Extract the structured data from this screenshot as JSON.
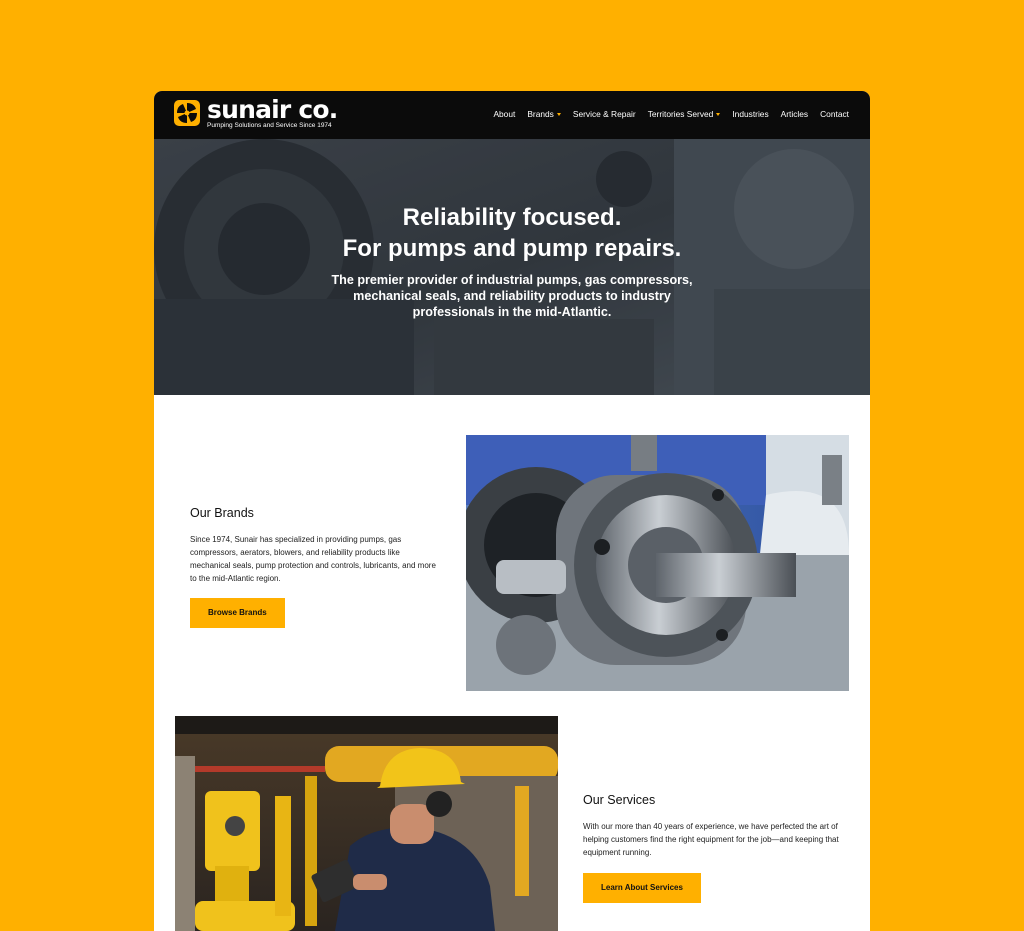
{
  "header": {
    "logo_name": "sunair co.",
    "logo_tagline": "Pumping Solutions and Service Since 1974",
    "nav": [
      {
        "label": "About",
        "has_dropdown": false
      },
      {
        "label": "Brands",
        "has_dropdown": true
      },
      {
        "label": "Service & Repair",
        "has_dropdown": false
      },
      {
        "label": "Territories Served",
        "has_dropdown": true
      },
      {
        "label": "Industries",
        "has_dropdown": false
      },
      {
        "label": "Articles",
        "has_dropdown": false
      },
      {
        "label": "Contact",
        "has_dropdown": false
      }
    ]
  },
  "hero": {
    "title_line1": "Reliability focused.",
    "title_line2": "For pumps and pump repairs.",
    "subtitle": "The premier provider of industrial pumps, gas compressors, mechanical seals, and reliability products to industry professionals in the mid-Atlantic."
  },
  "brands": {
    "title": "Our Brands",
    "body": "Since 1974, Sunair has specialized in providing pumps, gas compressors, aerators, blowers, and reliability products like mechanical seals, pump protection and controls, lubricants, and more to the mid-Atlantic region.",
    "button": "Browse Brands"
  },
  "services": {
    "title": "Our Services",
    "body": "With our more than 40 years of experience, we have perfected the art of helping customers find the right equipment for the job—and keeping that equipment running.",
    "button": "Learn About Services"
  },
  "colors": {
    "accent": "#FFB000",
    "header_bg": "#0b0b0b",
    "hero_bg": "#3d434a"
  }
}
